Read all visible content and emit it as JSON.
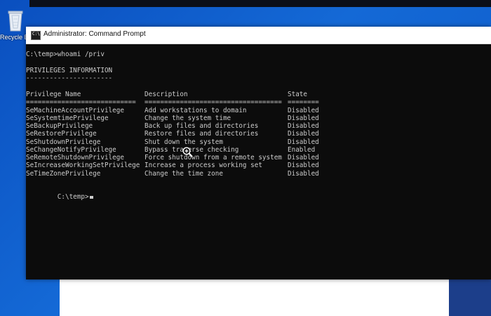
{
  "desktop": {
    "recycle_bin_label": "Recycle B"
  },
  "window": {
    "title": "Administrator: Command Prompt",
    "icon_text": "C:\\"
  },
  "console": {
    "command_line": "C:\\temp>whoami /priv",
    "section_title": "PRIVILEGES INFORMATION",
    "section_underline": "----------------------",
    "headers": {
      "name": "Privilege Name",
      "description": "Description",
      "state": "State"
    },
    "separators": {
      "name": "============================",
      "description": "===================================",
      "state": "========"
    },
    "rows": [
      {
        "name": "SeMachineAccountPrivilege",
        "description": "Add workstations to domain",
        "state": "Disabled"
      },
      {
        "name": "SeSystemtimePrivilege",
        "description": "Change the system time",
        "state": "Disabled"
      },
      {
        "name": "SeBackupPrivilege",
        "description": "Back up files and directories",
        "state": "Disabled"
      },
      {
        "name": "SeRestorePrivilege",
        "description": "Restore files and directories",
        "state": "Disabled"
      },
      {
        "name": "SeShutdownPrivilege",
        "description": "Shut down the system",
        "state": "Disabled"
      },
      {
        "name": "SeChangeNotifyPrivilege",
        "description": "Bypass traverse checking",
        "state": "Enabled"
      },
      {
        "name": "SeRemoteShutdownPrivilege",
        "description": "Force shutdown from a remote system",
        "state": "Disabled"
      },
      {
        "name": "SeIncreaseWorkingSetPrivilege",
        "description": "Increase a process working set",
        "state": "Disabled"
      },
      {
        "name": "SeTimeZonePrivilege",
        "description": "Change the time zone",
        "state": "Disabled"
      }
    ],
    "prompt": "C:\\temp>"
  },
  "colors": {
    "console_background": "#0c0c0c",
    "console_text": "#cccccc",
    "desktop_blue": "#0a59c8"
  },
  "icons": {
    "recycle_bin": "recycle-bin-icon",
    "cmd": "cmd-icon",
    "zoom_cursor": "zoom-cursor-icon"
  }
}
